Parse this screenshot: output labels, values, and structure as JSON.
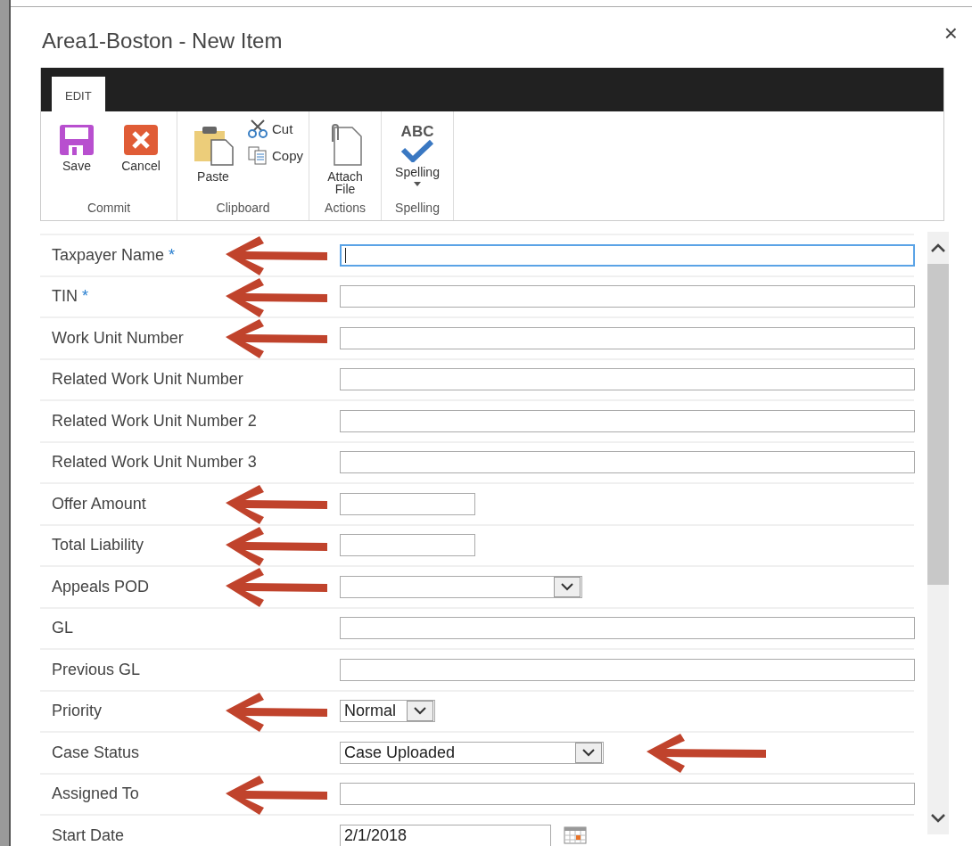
{
  "dialog": {
    "title": "Area1-Boston - New Item",
    "close": "×"
  },
  "ribbon": {
    "tabs": [
      {
        "label": "EDIT",
        "selected": true
      }
    ],
    "groups": [
      {
        "label": "Commit",
        "buttons": [
          {
            "label": "Save",
            "kind": "large"
          },
          {
            "label": "Cancel",
            "kind": "large"
          }
        ]
      },
      {
        "label": "Clipboard",
        "buttons": [
          {
            "label": "Paste",
            "kind": "large"
          },
          {
            "label": "Cut",
            "kind": "small"
          },
          {
            "label": "Copy",
            "kind": "small"
          }
        ]
      },
      {
        "label": "Actions",
        "buttons": [
          {
            "label": "Attach File",
            "kind": "large"
          }
        ]
      },
      {
        "label": "Spelling",
        "buttons": [
          {
            "label": "Spelling",
            "kind": "dropdown",
            "icon_text": "ABC"
          }
        ]
      }
    ]
  },
  "form": {
    "fields": [
      {
        "label": "Taxpayer Name",
        "required_mark": "*",
        "kind": "text",
        "focused": true,
        "arrow": {
          "kind": "before"
        }
      },
      {
        "label": "TIN",
        "required_mark": "*",
        "kind": "text",
        "arrow": {
          "kind": "before"
        }
      },
      {
        "label": "Work Unit Number",
        "kind": "text",
        "arrow": {
          "kind": "before"
        }
      },
      {
        "label": "Related Work Unit Number",
        "kind": "text"
      },
      {
        "label": "Related Work Unit Number 2",
        "kind": "text"
      },
      {
        "label": "Related Work Unit Number 3",
        "kind": "text"
      },
      {
        "label": "Offer Amount",
        "kind": "short",
        "arrow": {
          "kind": "before"
        }
      },
      {
        "label": "Total Liability",
        "kind": "short",
        "arrow": {
          "kind": "before"
        }
      },
      {
        "label": "Appeals POD",
        "kind": "select",
        "arrow": {
          "kind": "before"
        }
      },
      {
        "label": "GL",
        "kind": "text"
      },
      {
        "label": "Previous GL",
        "kind": "text"
      },
      {
        "label": "Priority",
        "kind": "select-small",
        "value": "Normal",
        "arrow": {
          "kind": "before"
        }
      },
      {
        "label": "Case Status",
        "kind": "select",
        "value": "Case Uploaded",
        "arrow": {
          "kind": "after"
        }
      },
      {
        "label": "Assigned To",
        "kind": "text",
        "arrow": {
          "kind": "before"
        }
      },
      {
        "label": "Start Date",
        "kind": "date",
        "value": "2/1/2018"
      }
    ]
  }
}
